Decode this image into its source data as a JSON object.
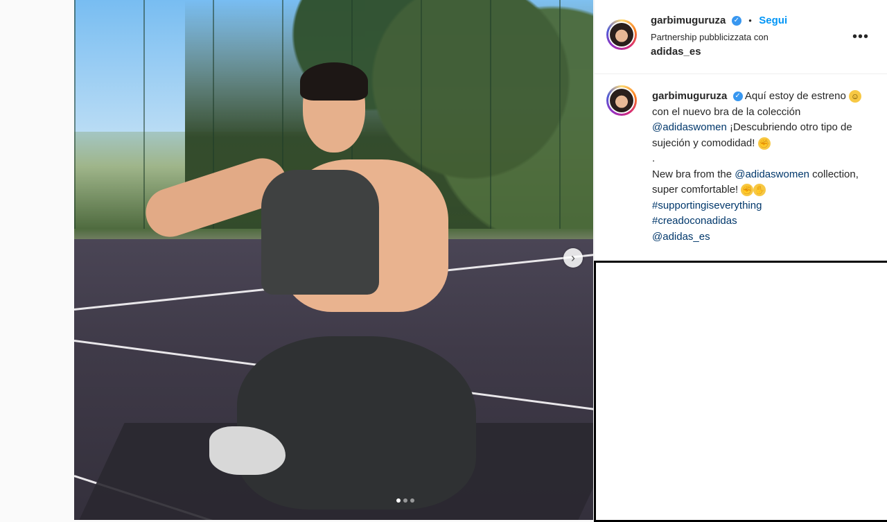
{
  "post": {
    "carousel": {
      "total": 3,
      "active_index": 0,
      "next_icon": "chevron-right-icon"
    }
  },
  "header": {
    "username": "garbimuguruza",
    "verified_icon": "verified-badge-icon",
    "separator": "•",
    "follow_label": "Segui",
    "partnership_text": "Partnership pubblicizzata con",
    "partner_name": "adidas_es",
    "more_icon": "more-options-icon",
    "more_label": "•••"
  },
  "caption": {
    "username": "garbimuguruza",
    "line1": " Aquí estoy de estreno ",
    "emoji_smile": "😃",
    "line1b": " con el nuevo bra de la colección ",
    "mention1": "@adidaswomen",
    "line2": " ¡Descubriendo otro tipo de sujeción y comodidad! ",
    "emoji_muscle": "💪",
    "dot": ".",
    "line3": "New bra from the ",
    "mention2": "@adidaswomen",
    "line3b": " collection, super comfortable! ",
    "emoji_clap": "👏",
    "hashtag1": "#supportingiseverything",
    "hashtag2": "#creadoconadidas",
    "mention3": "@adidas_es"
  },
  "colors": {
    "link": "#00376b",
    "follow": "#0095f6",
    "verified": "#3897f0"
  }
}
